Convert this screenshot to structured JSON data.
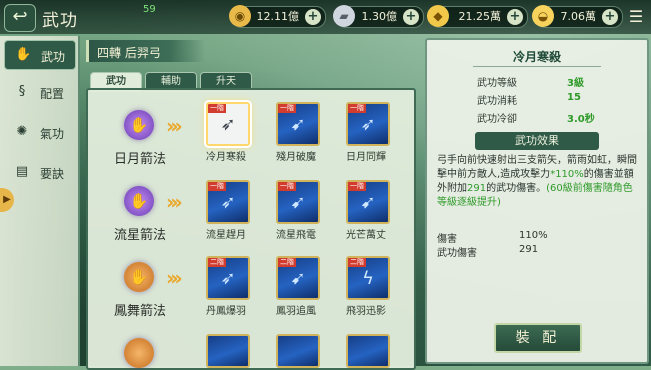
{
  "header": {
    "back_icon": "back-arrow-icon",
    "title": "武功",
    "level": "59",
    "resources": [
      {
        "name": "coin",
        "icon": "coin-icon",
        "value": "12.11億"
      },
      {
        "name": "silver",
        "icon": "silver-ingot-icon",
        "value": "1.30億"
      },
      {
        "name": "gold-ingot",
        "icon": "gold-ingot-icon",
        "value": "21.25萬"
      },
      {
        "name": "yuanbao",
        "icon": "yuanbao-icon",
        "value": "7.06萬"
      }
    ],
    "menu_icon": "menu-icon"
  },
  "sidebar": {
    "items": [
      {
        "label": "武功",
        "icon": "martial-arts-icon",
        "active": true
      },
      {
        "label": "配置",
        "icon": "config-icon"
      },
      {
        "label": "氣功",
        "icon": "qigong-icon"
      },
      {
        "label": "要訣",
        "icon": "manual-icon"
      }
    ]
  },
  "character": {
    "name": "四轉 后羿弓"
  },
  "tabs": [
    {
      "label": "武功",
      "active": true
    },
    {
      "label": "輔助"
    },
    {
      "label": "升天"
    }
  ],
  "skill_rows": [
    {
      "name": "日月箭法",
      "skills": [
        {
          "tag": "一階",
          "name": "冷月寒殺",
          "selected": true
        },
        {
          "tag": "一階",
          "name": "殘月破魔"
        },
        {
          "tag": "一階",
          "name": "日月同輝"
        }
      ]
    },
    {
      "name": "流星箭法",
      "skills": [
        {
          "tag": "一階",
          "name": "流星趕月"
        },
        {
          "tag": "一階",
          "name": "流星飛電"
        },
        {
          "tag": "一階",
          "name": "光芒萬丈"
        }
      ]
    },
    {
      "name": "鳳舞箭法",
      "skills": [
        {
          "tag": "二階",
          "name": "丹鳳爆羽"
        },
        {
          "tag": "二階",
          "name": "鳳羽追風"
        },
        {
          "tag": "二階",
          "name": "飛羽迅影"
        }
      ]
    }
  ],
  "detail": {
    "title": "冷月寒殺",
    "stats": [
      {
        "label": "武功等級",
        "value": "3級"
      },
      {
        "label": "武功消耗",
        "value": "15"
      },
      {
        "label": "武功冷卻",
        "value": "3.0秒"
      }
    ],
    "effect_header": "武功效果",
    "desc_part1": "弓手向前快速射出三支箭矢，箭雨如虹，瞬間擊中前方敵人,造成攻擊力",
    "desc_hl1": "*110%",
    "desc_part2": "的傷害並額外附加",
    "desc_hl2": "291",
    "desc_part3": "的武功傷害。",
    "desc_hl3": "(60級前傷害隨角色等級逐級提升)",
    "info": [
      {
        "label": "傷害",
        "value": "110%"
      },
      {
        "label": "武功傷害",
        "value": "291"
      }
    ],
    "equip_label": "裝 配"
  }
}
